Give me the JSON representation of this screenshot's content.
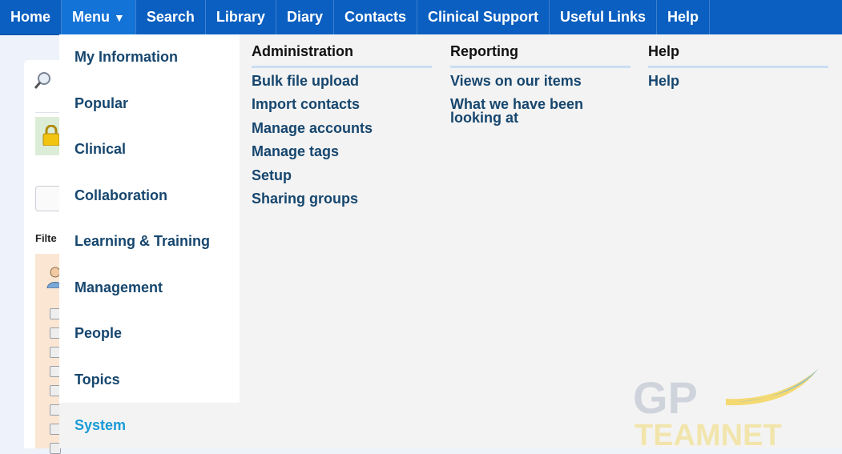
{
  "topnav": {
    "items": [
      {
        "label": "Home"
      },
      {
        "label": "Menu",
        "caret": "▼"
      },
      {
        "label": "Search"
      },
      {
        "label": "Library"
      },
      {
        "label": "Diary"
      },
      {
        "label": "Contacts"
      },
      {
        "label": "Clinical Support"
      },
      {
        "label": "Useful Links"
      },
      {
        "label": "Help"
      }
    ]
  },
  "background": {
    "filter_label": "Filte"
  },
  "menu": {
    "left_items": [
      {
        "label": "My Information"
      },
      {
        "label": "Popular"
      },
      {
        "label": "Clinical"
      },
      {
        "label": "Collaboration"
      },
      {
        "label": "Learning & Training"
      },
      {
        "label": "Management"
      },
      {
        "label": "People"
      },
      {
        "label": "Topics"
      },
      {
        "label": "System"
      }
    ],
    "columns": [
      {
        "heading": "Administration",
        "links": [
          "Bulk file upload",
          "Import contacts",
          "Manage accounts",
          "Manage tags",
          "Setup",
          "Sharing groups"
        ]
      },
      {
        "heading": "Reporting",
        "links": [
          "Views on our items",
          "What we have been looking at"
        ]
      },
      {
        "heading": "Help",
        "links": [
          "Help"
        ]
      }
    ]
  },
  "logo": {
    "line1": "GP",
    "line2": "TEAMNET"
  },
  "colors": {
    "nav_bg": "#0a5fc0",
    "link": "#16466e",
    "active_menu_item": "#1a9bd6",
    "menu_bg": "#f3f3f3"
  }
}
